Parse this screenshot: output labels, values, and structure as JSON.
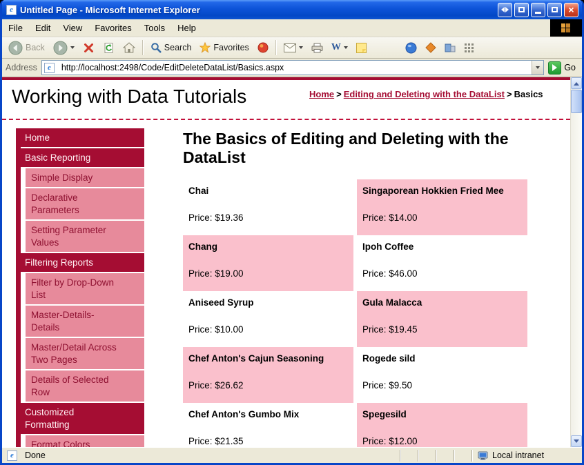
{
  "window": {
    "title": "Untitled Page - Microsoft Internet Explorer",
    "status_text": "Done",
    "zone_text": "Local intranet"
  },
  "icons": {
    "ie_e": "e",
    "word_w": "W",
    "close_x": "×"
  },
  "menu": {
    "items": [
      "File",
      "Edit",
      "View",
      "Favorites",
      "Tools",
      "Help"
    ]
  },
  "toolbar": {
    "back": "Back",
    "search": "Search",
    "favorites": "Favorites"
  },
  "address": {
    "label": "Address",
    "url": "http://localhost:2498/Code/EditDeleteDataList/Basics.aspx",
    "go": "Go"
  },
  "page": {
    "site_title": "Working with Data Tutorials",
    "breadcrumb": {
      "home": "Home",
      "sep1": ">",
      "section": "Editing and Deleting with the DataList",
      "sep2": ">",
      "current": "Basics"
    },
    "heading": "The Basics of Editing and Deleting with the DataList",
    "sidebar": {
      "items": [
        {
          "label": "Home",
          "type": "section"
        },
        {
          "label": "Basic Reporting",
          "type": "section"
        },
        {
          "label": "Simple Display",
          "type": "sub"
        },
        {
          "label": "Declarative Parameters",
          "type": "sub"
        },
        {
          "label": "Setting Parameter Values",
          "type": "sub"
        },
        {
          "label": "Filtering Reports",
          "type": "section"
        },
        {
          "label": "Filter by Drop-Down List",
          "type": "sub"
        },
        {
          "label": "Master-Details-Details",
          "type": "sub"
        },
        {
          "label": "Master/Detail Across Two Pages",
          "type": "sub"
        },
        {
          "label": "Details of Selected Row",
          "type": "sub"
        },
        {
          "label": "Customized Formatting",
          "type": "section"
        },
        {
          "label": "Format Colors",
          "type": "sub"
        }
      ]
    },
    "products": [
      {
        "name": "Chai",
        "price": "Price: $19.36"
      },
      {
        "name": "Singaporean Hokkien Fried Mee",
        "price": "Price: $14.00"
      },
      {
        "name": "Chang",
        "price": "Price: $19.00"
      },
      {
        "name": "Ipoh Coffee",
        "price": "Price: $46.00"
      },
      {
        "name": "Aniseed Syrup",
        "price": "Price: $10.00"
      },
      {
        "name": "Gula Malacca",
        "price": "Price: $19.45"
      },
      {
        "name": "Chef Anton's Cajun Seasoning",
        "price": "Price: $26.62"
      },
      {
        "name": "Rogede sild",
        "price": "Price: $9.50"
      },
      {
        "name": "Chef Anton's Gumbo Mix",
        "price": "Price: $21.35"
      },
      {
        "name": "Spegesild",
        "price": "Price: $12.00"
      }
    ]
  },
  "colors": {
    "maroon": "#A50D33",
    "sidebar_pink": "#E78A9B",
    "cell_pink": "#FAC0CC",
    "titlebar_blue": "#0D53D8",
    "chrome_tan": "#ECE9D8",
    "go_green": "#1E9A31"
  }
}
